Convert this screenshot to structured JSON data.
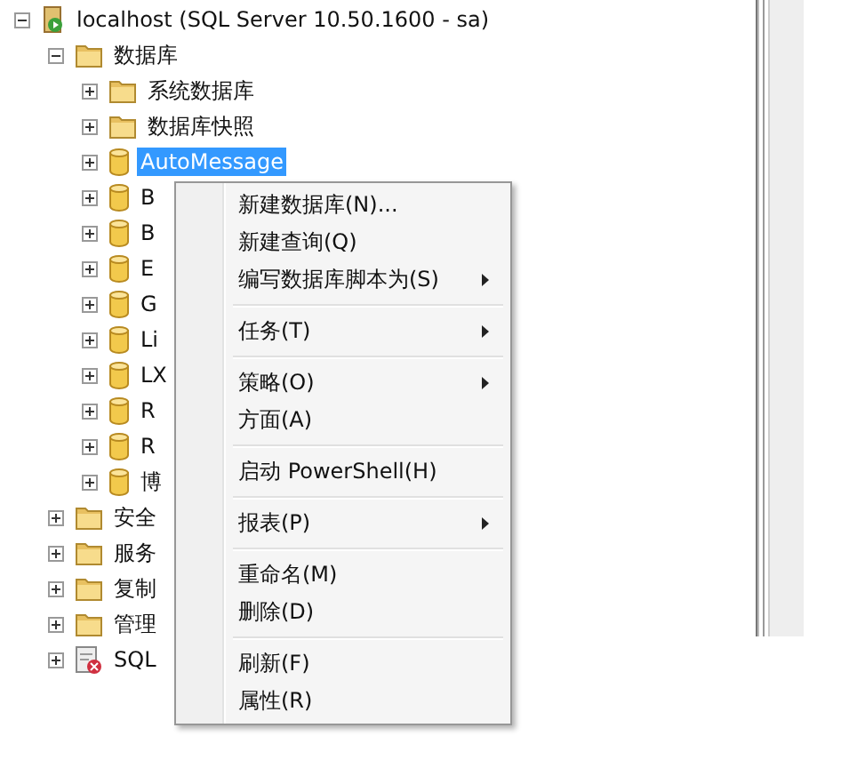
{
  "tree": [
    {
      "label": "localhost (SQL Server 10.50.1600 - sa)",
      "kind": "server",
      "expanded": true,
      "selected": false,
      "children": [
        {
          "label": "数据库",
          "kind": "folder",
          "expanded": true,
          "selected": false,
          "children": [
            {
              "label": "系统数据库",
              "kind": "folder",
              "expanded": false,
              "selected": false
            },
            {
              "label": "数据库快照",
              "kind": "folder",
              "expanded": false,
              "selected": false
            },
            {
              "label": "AutoMessage",
              "kind": "database",
              "expanded": false,
              "selected": true
            },
            {
              "label": "B",
              "kind": "database",
              "expanded": false,
              "selected": false
            },
            {
              "label": "B",
              "kind": "database",
              "expanded": false,
              "selected": false
            },
            {
              "label": "E",
              "kind": "database",
              "expanded": false,
              "selected": false
            },
            {
              "label": "G",
              "kind": "database",
              "expanded": false,
              "selected": false
            },
            {
              "label": "Li",
              "kind": "database",
              "expanded": false,
              "selected": false
            },
            {
              "label": "LX",
              "kind": "database",
              "expanded": false,
              "selected": false
            },
            {
              "label": "R",
              "kind": "database",
              "expanded": false,
              "selected": false
            },
            {
              "label": "R",
              "kind": "database",
              "expanded": false,
              "selected": false
            },
            {
              "label": "博",
              "kind": "database",
              "expanded": false,
              "selected": false
            }
          ]
        },
        {
          "label": "安全",
          "kind": "folder",
          "expanded": false,
          "selected": false
        },
        {
          "label": "服务",
          "kind": "folder",
          "expanded": false,
          "selected": false
        },
        {
          "label": "复制",
          "kind": "folder",
          "expanded": false,
          "selected": false
        },
        {
          "label": "管理",
          "kind": "folder",
          "expanded": false,
          "selected": false
        },
        {
          "label": "SQL",
          "kind": "agent",
          "expanded": false,
          "selected": false
        }
      ]
    }
  ],
  "context_menu": {
    "groups": [
      [
        {
          "label": "新建数据库(N)...",
          "submenu": false
        },
        {
          "label": "新建查询(Q)",
          "submenu": false
        },
        {
          "label": "编写数据库脚本为(S)",
          "submenu": true
        }
      ],
      [
        {
          "label": "任务(T)",
          "submenu": true
        }
      ],
      [
        {
          "label": "策略(O)",
          "submenu": true
        },
        {
          "label": "方面(A)",
          "submenu": false
        }
      ],
      [
        {
          "label": "启动 PowerShell(H)",
          "submenu": false
        }
      ],
      [
        {
          "label": "报表(P)",
          "submenu": true
        }
      ],
      [
        {
          "label": "重命名(M)",
          "submenu": false
        },
        {
          "label": "删除(D)",
          "submenu": false
        }
      ],
      [
        {
          "label": "刷新(F)",
          "submenu": false
        },
        {
          "label": "属性(R)",
          "submenu": false
        }
      ]
    ]
  }
}
